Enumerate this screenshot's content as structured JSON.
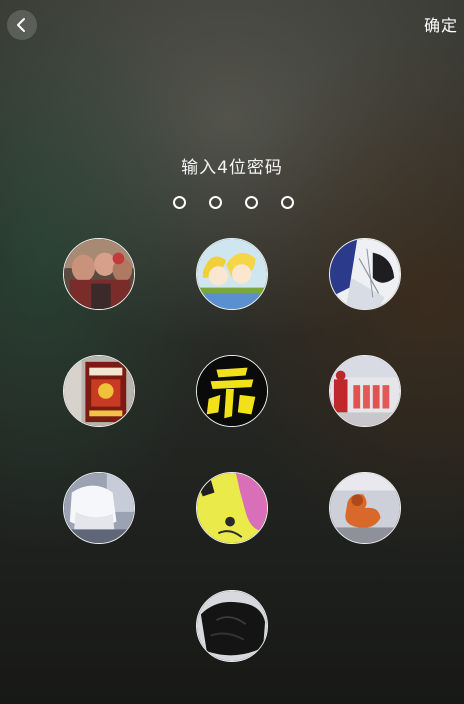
{
  "header": {
    "back_icon": "chevron-left-icon",
    "confirm_label": "确定"
  },
  "prompt": {
    "title": "输入4位密码"
  },
  "pin": {
    "length": 4,
    "entered": 0
  },
  "keypad": {
    "keys": [
      {
        "row": 1,
        "col": 1,
        "image": "group-photo-people"
      },
      {
        "row": 1,
        "col": 2,
        "image": "anime-yellow-hair-characters"
      },
      {
        "row": 1,
        "col": 3,
        "image": "anime-girl-sketch"
      },
      {
        "row": 2,
        "col": 1,
        "image": "red-poster-book-cover"
      },
      {
        "row": 2,
        "col": 2,
        "image": "yellow-calligraphy-on-black"
      },
      {
        "row": 2,
        "col": 3,
        "image": "red-stage-performers"
      },
      {
        "row": 3,
        "col": 1,
        "image": "white-plush-toy"
      },
      {
        "row": 3,
        "col": 2,
        "image": "yellow-pink-cartoon"
      },
      {
        "row": 3,
        "col": 3,
        "image": "orange-figurine"
      },
      {
        "row": 4,
        "col": 2,
        "image": "black-fabric"
      }
    ]
  },
  "colors": {
    "pin_dot": "#ffffff",
    "key_border": "#ffffff",
    "text": "#f4f4f4"
  }
}
